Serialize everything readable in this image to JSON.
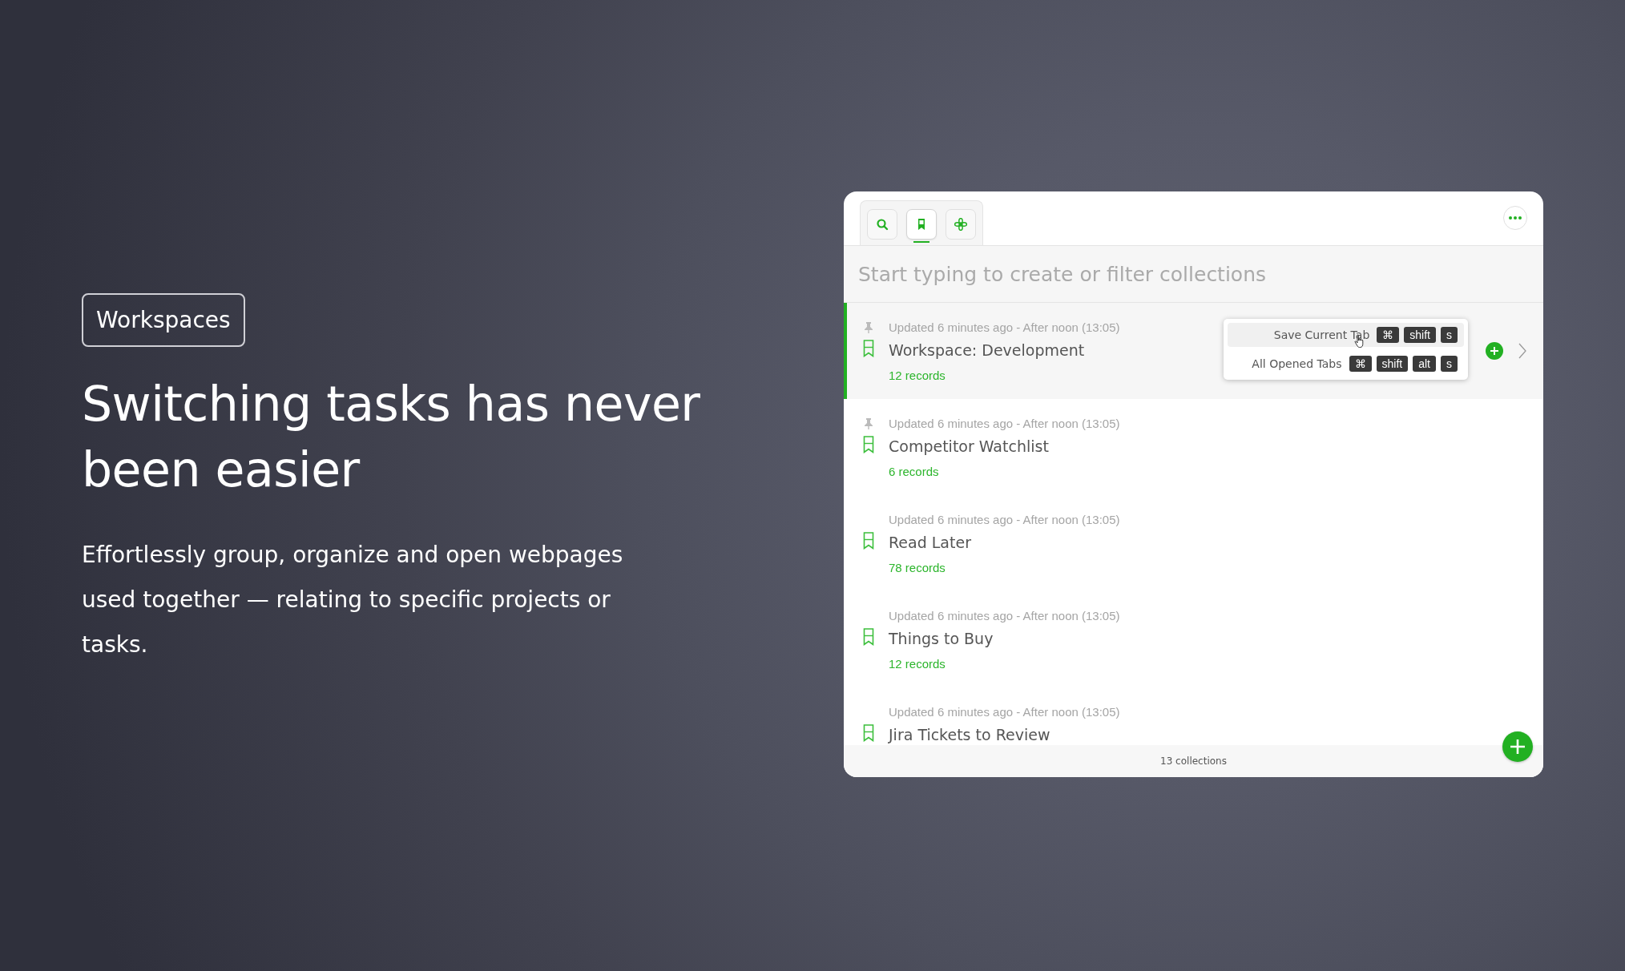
{
  "badge": "Workspaces",
  "headline": "Switching tasks has never been easier",
  "description": "Effortlessly group, organize and open webpages used together — relating to specific projects or tasks.",
  "app": {
    "tabs": [
      {
        "kind": "search",
        "selected": false
      },
      {
        "kind": "bookmark",
        "selected": true
      },
      {
        "kind": "flower",
        "selected": false
      }
    ],
    "search": {
      "placeholder": "Start typing to create or filter collections"
    },
    "collections": [
      {
        "updated": "Updated 6 minutes ago - After noon (13:05)",
        "name": "Workspace: Development",
        "records": "12 records",
        "pinned": true,
        "selected": true
      },
      {
        "updated": "Updated 6 minutes ago - After noon (13:05)",
        "name": "Competitor Watchlist",
        "records": "6 records",
        "pinned": true,
        "selected": false
      },
      {
        "updated": "Updated 6 minutes ago - After noon (13:05)",
        "name": "Read Later",
        "records": "78 records",
        "pinned": false,
        "selected": false
      },
      {
        "updated": "Updated 6 minutes ago - After noon (13:05)",
        "name": "Things to Buy",
        "records": "12 records",
        "pinned": false,
        "selected": false
      },
      {
        "updated": "Updated 6 minutes ago - After noon (13:05)",
        "name": "Jira Tickets to Review",
        "pinned": false,
        "selected": false
      }
    ],
    "save_menu": [
      {
        "label": "Save Current Tab",
        "keys": [
          "⌘",
          "shift",
          "s"
        ],
        "highlighted": true
      },
      {
        "label": "All Opened Tabs",
        "keys": [
          "⌘",
          "shift",
          "alt",
          "s"
        ],
        "highlighted": false
      }
    ],
    "footer": "13 collections"
  }
}
